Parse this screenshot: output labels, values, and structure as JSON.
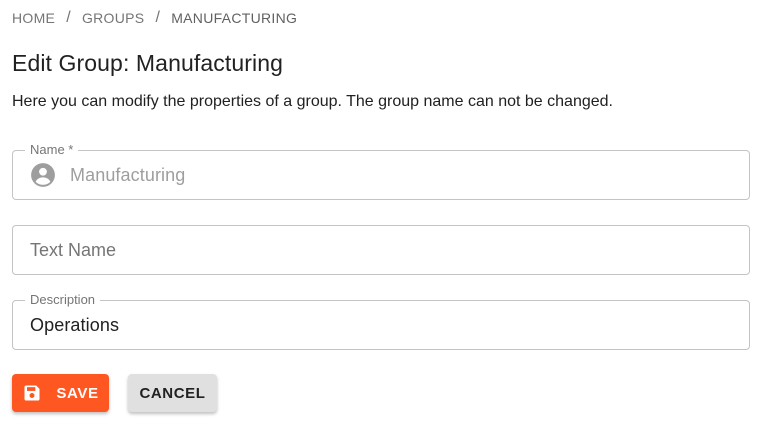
{
  "breadcrumb": {
    "items": [
      {
        "label": "HOME"
      },
      {
        "label": "GROUPS"
      },
      {
        "label": "MANUFACTURING"
      }
    ],
    "separator": "/"
  },
  "header": {
    "title": "Edit Group: Manufacturing",
    "description": "Here you can modify the properties of a group. The group name can not be changed."
  },
  "form": {
    "name": {
      "label": "Name *",
      "value": "Manufacturing",
      "icon": "account-circle-icon",
      "disabled": true
    },
    "text_name": {
      "placeholder": "Text Name",
      "value": ""
    },
    "description": {
      "label": "Description",
      "value": "Operations"
    }
  },
  "actions": {
    "save_label": "SAVE",
    "save_icon": "floppy-disk-icon",
    "cancel_label": "CANCEL"
  },
  "colors": {
    "accent": "#ff5722",
    "cancel_bg": "#e0e0e0",
    "border": "#c4c4c4",
    "muted_text": "#757575",
    "disabled_text": "#9e9e9e"
  }
}
